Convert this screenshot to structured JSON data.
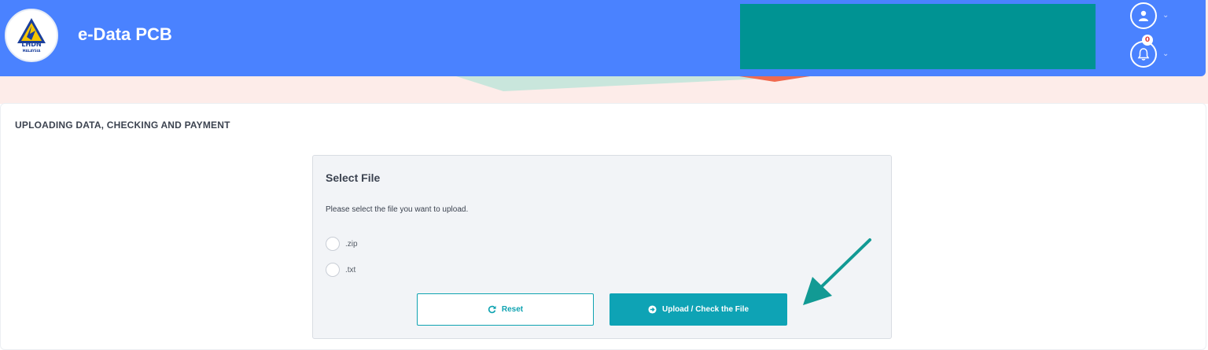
{
  "header": {
    "logo_text": "LHDN",
    "logo_subtext": "MALAYSIA",
    "app_title": "e-Data PCB",
    "notification_count": "0",
    "icons": [
      "user-icon",
      "bell-icon",
      "chevron-down-icon"
    ]
  },
  "main": {
    "section_title": "UPLOADING DATA, CHECKING AND PAYMENT",
    "panel": {
      "title": "Select File",
      "description": "Please select the file you want to upload.",
      "options": [
        ".zip",
        ".txt"
      ],
      "reset_label": "Reset",
      "upload_label": "Upload / Check the File"
    }
  },
  "colors": {
    "header_bg": "#4a82ff",
    "redaction": "#009393",
    "accent": "#0ea3b5",
    "annotation_arrow": "#129a94",
    "panel_bg": "#f2f4f7",
    "band_bg": "#fdece9"
  }
}
